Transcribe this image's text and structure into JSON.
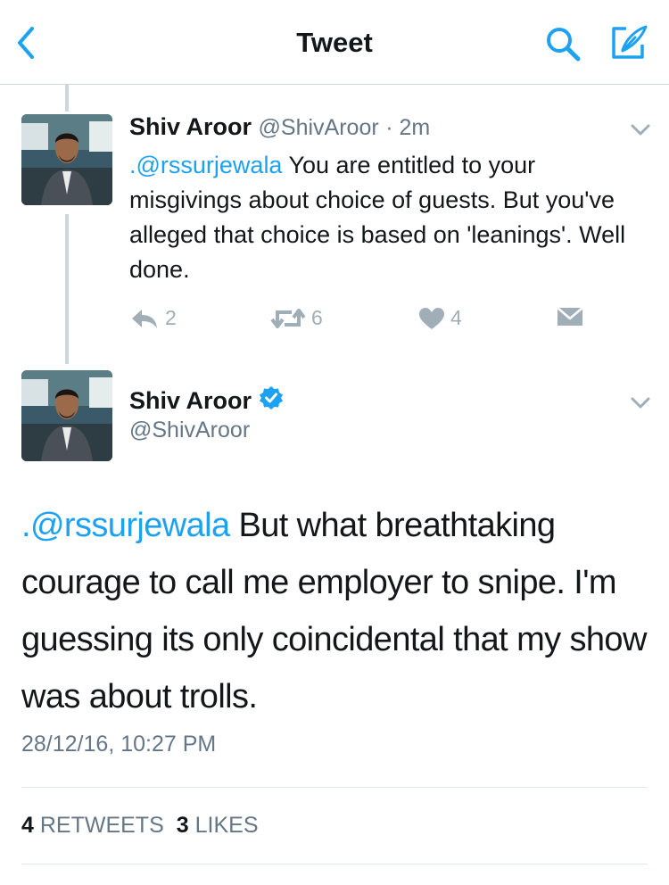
{
  "nav": {
    "title": "Tweet"
  },
  "parent_tweet": {
    "name": "Shiv Aroor",
    "handle": "@ShivAroor",
    "time": "· 2m",
    "mention": ".@rssurjewala",
    "text": " You are entitled to your misgivings about choice of guests. But you've alleged that choice is based on 'leanings'. Well done.",
    "replies": "2",
    "retweets": "6",
    "likes": "4"
  },
  "main_tweet": {
    "name": "Shiv Aroor",
    "handle": "@ShivAroor",
    "verified": true,
    "mention": ".@rssurjewala",
    "text": " But what breathtaking courage to call me employer to snipe. I'm guessing its only coincidental that my show was about trolls.",
    "timestamp": "28/12/16, 10:27 PM",
    "retweet_count": "4",
    "retweets_label": "RETWEETS",
    "like_count": "3",
    "likes_label": "LIKES"
  },
  "colors": {
    "accent": "#1da1f2",
    "text": "#14171a",
    "muted": "#657786",
    "icon": "#a0aeb8"
  }
}
